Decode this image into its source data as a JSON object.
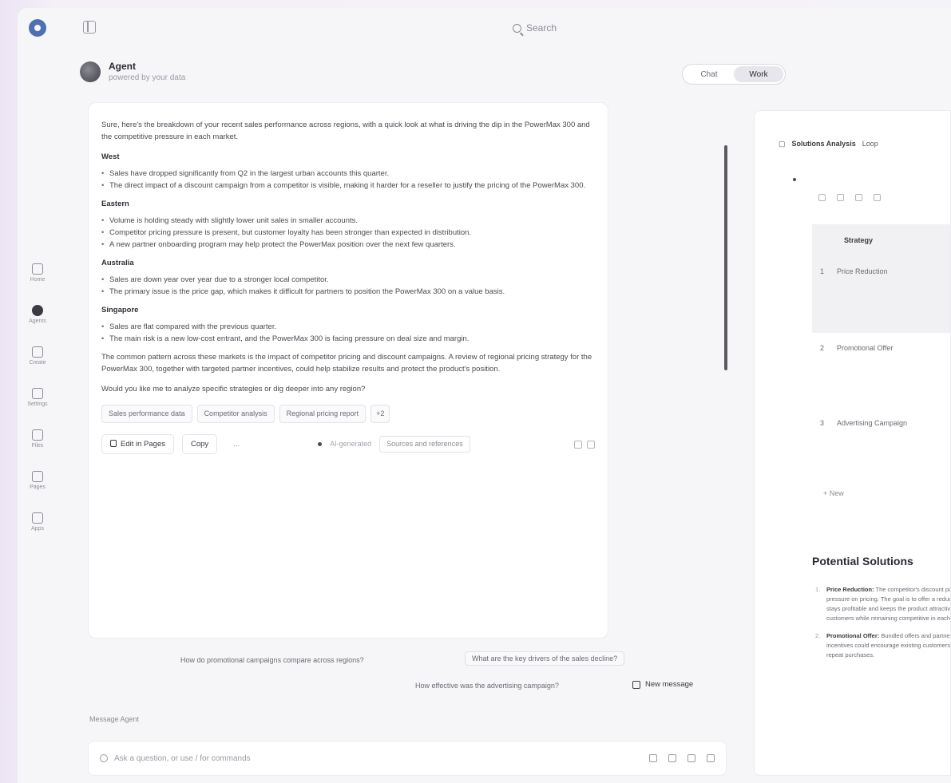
{
  "app": {
    "search_placeholder": "Search"
  },
  "rail": [
    {
      "label": "Home"
    },
    {
      "label": "Agents"
    },
    {
      "label": "Create"
    },
    {
      "label": "Settings"
    },
    {
      "label": "Files"
    },
    {
      "label": "Pages"
    },
    {
      "label": "Apps"
    }
  ],
  "agent": {
    "name": "Agent",
    "subtitle": "powered by your data"
  },
  "view_toggle": {
    "left": "Chat",
    "right": "Work"
  },
  "message": {
    "intro": "Sure, here's the breakdown of your recent sales performance across regions, with a quick look at what is driving the dip in the PowerMax 300 and the competitive pressure in each market.",
    "sections": [
      {
        "heading": "West",
        "items": [
          "Sales have dropped significantly from Q2 in the largest urban accounts this quarter.",
          "The direct impact of a discount campaign from a competitor is visible, making it harder for a reseller to justify the pricing of the PowerMax 300."
        ]
      },
      {
        "heading": "Eastern",
        "items": [
          "Volume is holding steady with slightly lower unit sales in smaller accounts.",
          "Competitor pricing pressure is present, but customer loyalty has been stronger than expected in distribution.",
          "A new partner onboarding program may help protect the PowerMax position over the next few quarters."
        ]
      },
      {
        "heading": "Australia",
        "items": [
          "Sales are down year over year due to a stronger local competitor.",
          "The primary issue is the price gap, which makes it difficult for partners to position the PowerMax 300 on a value basis."
        ]
      },
      {
        "heading": "Singapore",
        "items": [
          "Sales are flat compared with the previous quarter.",
          "The main risk is a new low-cost entrant, and the PowerMax 300 is facing pressure on deal size and margin."
        ]
      }
    ],
    "summary": "The common pattern across these markets is the impact of competitor pricing and discount campaigns. A review of regional pricing strategy for the PowerMax 300, together with targeted partner incentives, could help stabilize results and protect the product's position.",
    "followup": "Would you like me to analyze specific strategies or dig deeper into any region?",
    "chips": [
      "Sales performance data",
      "Competitor analysis",
      "Regional pricing report",
      "+2"
    ],
    "actions": {
      "edit": "Edit in Pages",
      "copy": "Copy",
      "more": "...",
      "ai_note": "AI-generated",
      "references": "Sources and references"
    }
  },
  "suggestions": [
    "How do promotional campaigns compare across regions?",
    "What are the key drivers of the sales decline?",
    "How effective was the advertising campaign?"
  ],
  "new_message": "New message",
  "composer": {
    "label": "Message Agent",
    "placeholder": "Ask a question, or use / for commands"
  },
  "right_panel": {
    "breadcrumb": "Solutions Analysis",
    "breadcrumb_extra": "Loop",
    "table_header": "Strategy",
    "rows": [
      {
        "num": "1",
        "label": "Price Reduction"
      },
      {
        "num": "2",
        "label": "Promotional Offer"
      },
      {
        "num": "3",
        "label": "Advertising Campaign"
      }
    ],
    "new_row": "+ New",
    "heading": "Potential Solutions",
    "items": [
      {
        "num": "1.",
        "title": "Price Reduction:",
        "text": "The competitor's discount puts pressure on pricing. The goal is to offer a reduction that stays profitable and keeps the product attractive to customers while remaining competitive in each market."
      },
      {
        "num": "2.",
        "title": "Promotional Offer:",
        "text": "Bundled offers and partner incentives could encourage existing customers to repeat purchases."
      }
    ]
  }
}
